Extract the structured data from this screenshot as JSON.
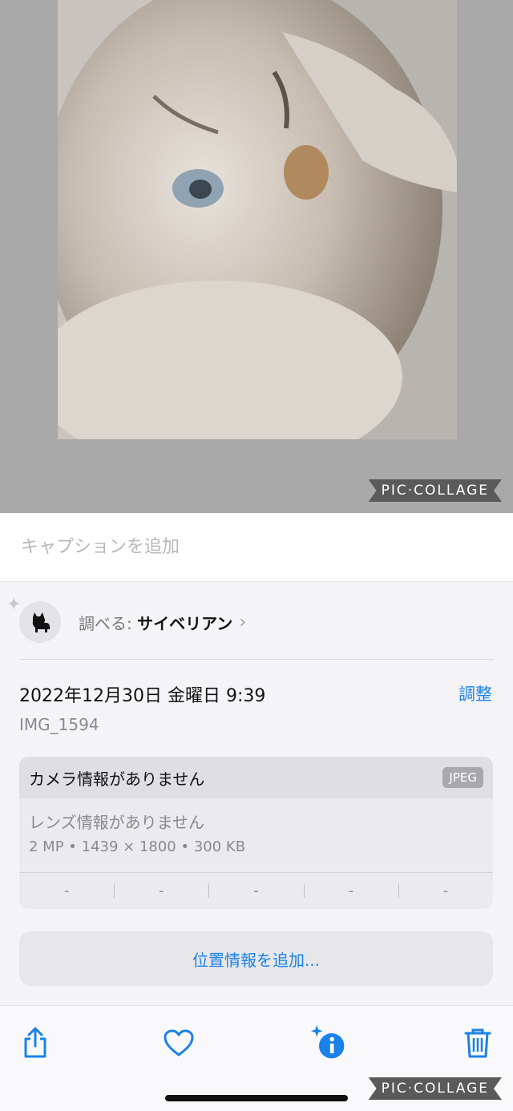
{
  "photo": {
    "watermark": "PIC·COLLAGE"
  },
  "caption": {
    "placeholder": "キャプションを追加"
  },
  "lookup": {
    "prefix": "調べる: ",
    "subject": "サイベリアン",
    "chevron": "›"
  },
  "datetime": {
    "text": "2022年12月30日 金曜日 9:39",
    "adjust_label": "調整"
  },
  "file": {
    "name": "IMG_1594"
  },
  "camera": {
    "title": "カメラ情報がありません",
    "format_badge": "JPEG",
    "lens": "レンズ情報がありません",
    "specs": "2 MP • 1439 × 1800 • 300 KB",
    "exif": [
      "-",
      "-",
      "-",
      "-",
      "-"
    ]
  },
  "location": {
    "add_label": "位置情報を追加..."
  },
  "toolbar": {
    "icons": [
      "share-icon",
      "heart-icon",
      "info-icon",
      "trash-icon"
    ]
  },
  "colors": {
    "accent": "#1a82e8",
    "sheet_bg": "#f4f4f6",
    "photo_bg": "#a9a9a9"
  }
}
